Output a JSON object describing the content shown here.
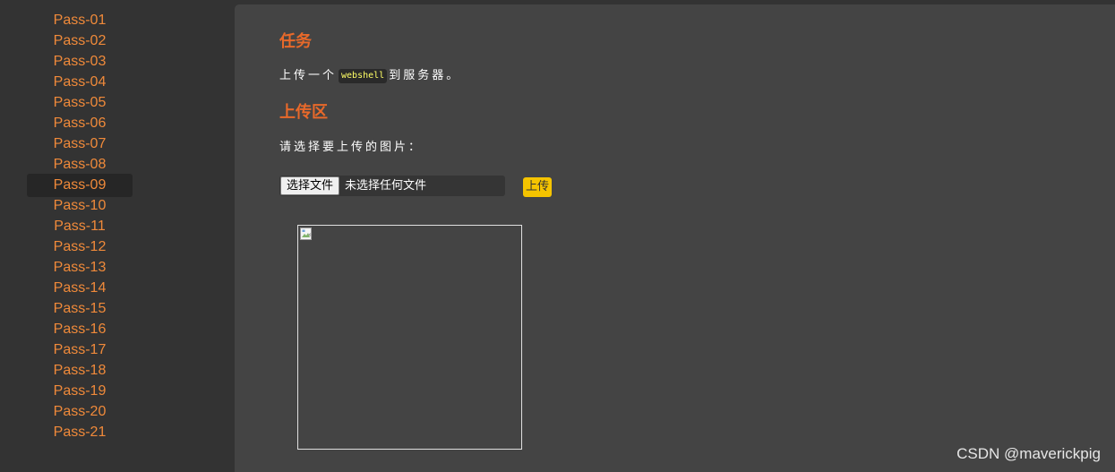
{
  "sidebar": {
    "items": [
      {
        "label": "Pass-01"
      },
      {
        "label": "Pass-02"
      },
      {
        "label": "Pass-03"
      },
      {
        "label": "Pass-04"
      },
      {
        "label": "Pass-05"
      },
      {
        "label": "Pass-06"
      },
      {
        "label": "Pass-07"
      },
      {
        "label": "Pass-08"
      },
      {
        "label": "Pass-09"
      },
      {
        "label": "Pass-10"
      },
      {
        "label": "Pass-11"
      },
      {
        "label": "Pass-12"
      },
      {
        "label": "Pass-13"
      },
      {
        "label": "Pass-14"
      },
      {
        "label": "Pass-15"
      },
      {
        "label": "Pass-16"
      },
      {
        "label": "Pass-17"
      },
      {
        "label": "Pass-18"
      },
      {
        "label": "Pass-19"
      },
      {
        "label": "Pass-20"
      },
      {
        "label": "Pass-21"
      }
    ],
    "active_item": "Pass-09"
  },
  "task": {
    "title": "任务",
    "text_before": "上传一个",
    "code": "webshell",
    "text_after": "到服务器。"
  },
  "upload": {
    "title": "上传区",
    "prompt": "请选择要上传的图片：",
    "choose_file_label": "选择文件",
    "no_file_text": "未选择任何文件",
    "upload_button_label": "上传"
  },
  "watermark": "CSDN @maverickpig",
  "colors": {
    "accent_orange": "#e8692a",
    "nav_link": "#f08a3a",
    "upload_button": "#f5c400",
    "code_text": "#ffff66"
  },
  "icons": {
    "preview": "broken-image-icon"
  }
}
